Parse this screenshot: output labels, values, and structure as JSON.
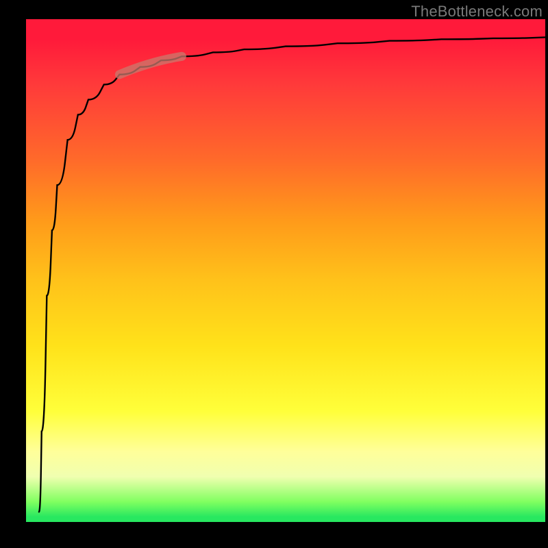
{
  "watermark": "TheBottleneck.com",
  "colors": {
    "page_bg": "#000000",
    "curve": "#000000",
    "highlight_stroke": "#c97a6e",
    "gradient_top": "#ff1a3a",
    "gradient_bottom": "#28e860"
  },
  "chart_data": {
    "type": "line",
    "title": "",
    "xlabel": "",
    "ylabel": "",
    "xlim": [
      0,
      100
    ],
    "ylim": [
      0,
      100
    ],
    "background": "vertical-gradient red→orange→yellow→green",
    "x": [
      2.5,
      3,
      4,
      5,
      6,
      8,
      10,
      12,
      15,
      18,
      22,
      26,
      30,
      36,
      42,
      50,
      60,
      70,
      80,
      90,
      100
    ],
    "values": [
      2,
      18,
      45,
      58,
      67,
      76,
      81,
      84,
      87,
      89,
      90.5,
      91.8,
      92.6,
      93.4,
      94,
      94.6,
      95.2,
      95.7,
      96,
      96.2,
      96.4
    ],
    "annotations": [
      {
        "kind": "highlight-segment",
        "x_start": 18,
        "x_end": 30,
        "y_start": 89,
        "y_end": 92.6
      }
    ]
  }
}
